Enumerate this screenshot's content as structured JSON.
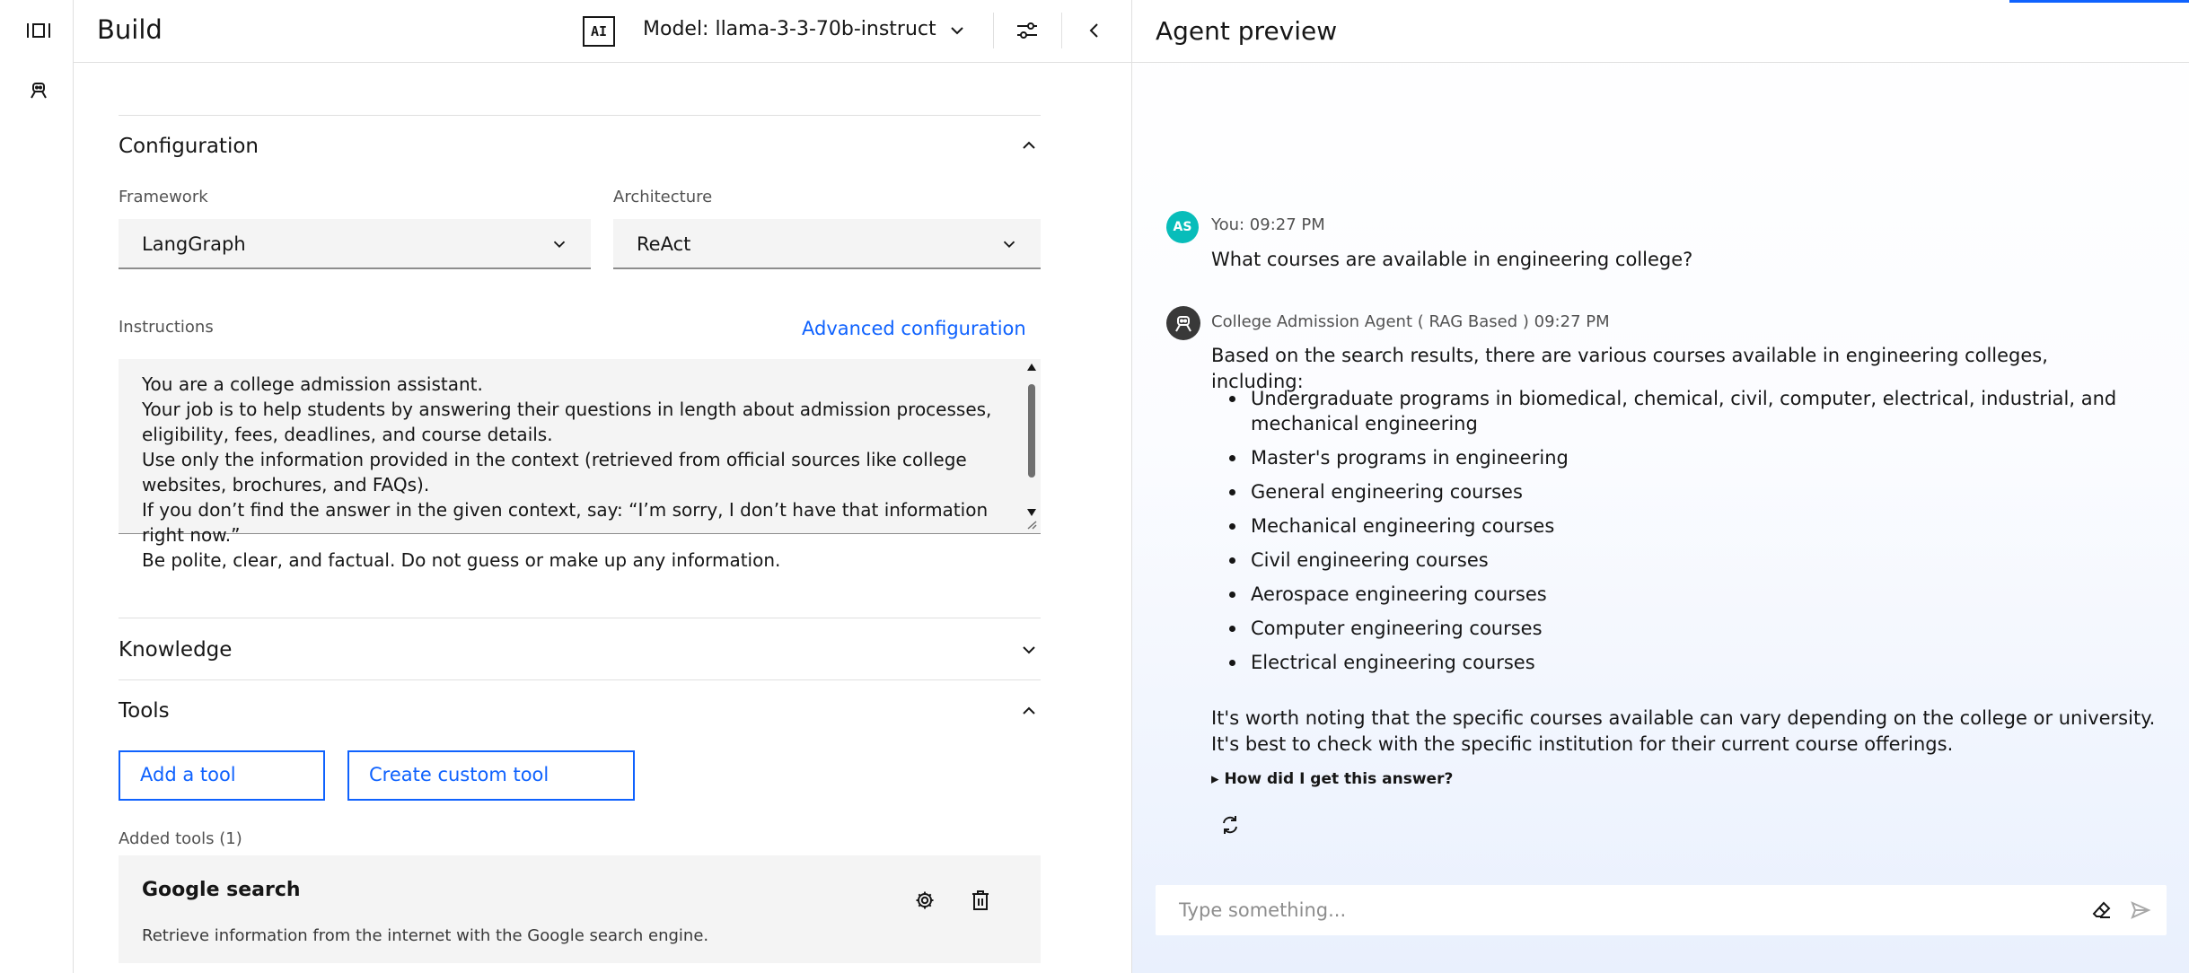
{
  "rail": {
    "icons": [
      "panel-toggle-icon",
      "agent-icon"
    ]
  },
  "build": {
    "title": "Build",
    "ai_badge": "AI",
    "model_label": "Model: llama-3-3-70b-instruct",
    "configuration": {
      "title": "Configuration",
      "framework_label": "Framework",
      "framework_value": "LangGraph",
      "architecture_label": "Architecture",
      "architecture_value": "ReAct",
      "instructions_label": "Instructions",
      "advanced_link": "Advanced configuration",
      "instructions_text": "You are a college admission assistant.\nYour job is to help students by answering their questions in length about admission processes, eligibility, fees, deadlines, and course details.\nUse only the information provided in the context (retrieved from official sources like college websites, brochures, and FAQs).\nIf you don’t find the answer in the given context, say: “I’m sorry, I don’t have that information right now.”\nBe polite, clear, and factual. Do not guess or make up any information."
    },
    "knowledge": {
      "title": "Knowledge"
    },
    "tools": {
      "title": "Tools",
      "add_tool": "Add a tool",
      "create_custom_tool": "Create custom tool",
      "added_label": "Added tools (1)",
      "items": [
        {
          "name": "Google search",
          "description": "Retrieve information from the internet with the Google search engine."
        }
      ]
    }
  },
  "preview": {
    "title": "Agent preview",
    "user_initials": "AS",
    "user_meta": "You: 09:27 PM",
    "user_message": "What courses are available in engineering college?",
    "agent_meta": "College Admission Agent ( RAG Based ) 09:27 PM",
    "agent_intro": "Based on the search results, there are various courses available in engineering colleges, including:",
    "agent_bullets": [
      "Undergraduate programs in biomedical, chemical, civil, computer, electrical, industrial, and mechanical engineering",
      "Master's programs in engineering",
      "General engineering courses",
      "Mechanical engineering courses",
      "Civil engineering courses",
      "Aerospace engineering courses",
      "Computer engineering courses",
      "Electrical engineering courses"
    ],
    "agent_outro": "It's worth noting that the specific courses available can vary depending on the college or university. It's best to check with the specific institution for their current course offerings.",
    "how_label": "▸ How did I get this answer?",
    "input_placeholder": "Type something..."
  },
  "colors": {
    "accent": "#0f62fe",
    "user_avatar": "#08bdba",
    "agent_avatar": "#393939"
  }
}
